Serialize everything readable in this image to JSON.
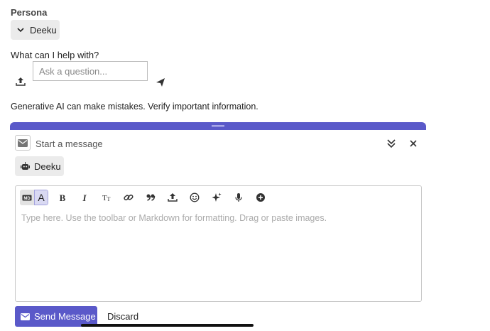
{
  "persona": {
    "label": "Persona",
    "selected": "Deeku"
  },
  "help": {
    "prompt": "What can I help with?",
    "placeholder": "Ask a question..."
  },
  "disclaimer": "Generative AI can make mistakes. Verify important information.",
  "composer": {
    "title": "Start a message",
    "recipient": "Deeku",
    "editor_placeholder": "Type here. Use the toolbar or Markdown for formatting. Drag or paste images.",
    "toolbar": {
      "markdown_mode": "MD",
      "rich_mode": "A",
      "tools": [
        "bold-icon",
        "italic-icon",
        "text-size-icon",
        "link-icon",
        "quote-icon",
        "upload-icon",
        "emoji-icon",
        "sparkle-icon",
        "microphone-icon",
        "add-icon"
      ]
    },
    "send_label": "Send Message",
    "discard_label": "Discard"
  },
  "colors": {
    "accent": "#5a59c9",
    "chip_bg": "#ebebeb"
  }
}
